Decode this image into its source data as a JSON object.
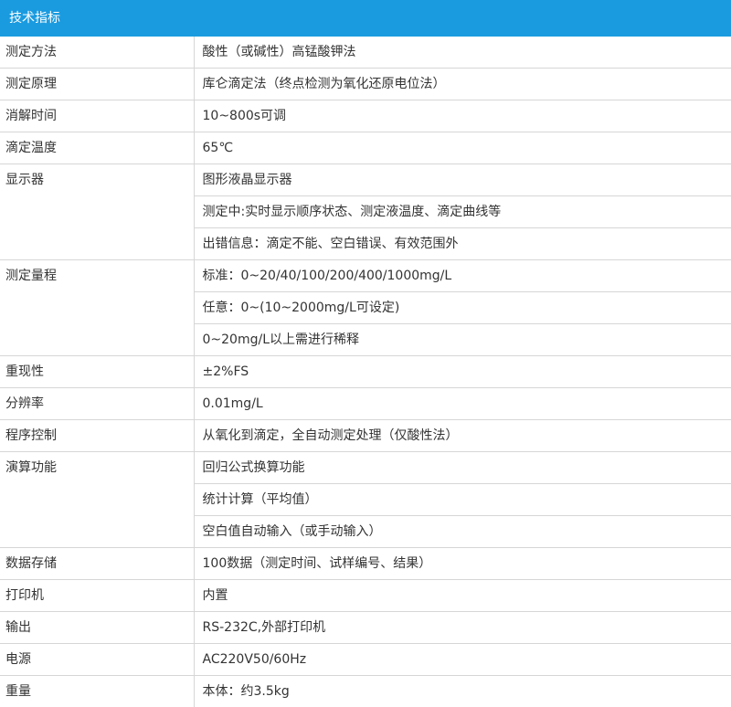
{
  "header": {
    "title": "技术指标"
  },
  "rows": [
    {
      "label": "测定方法",
      "values": [
        "酸性（或碱性）高锰酸钾法"
      ]
    },
    {
      "label": "测定原理",
      "values": [
        "库仑滴定法（终点检测为氧化还原电位法）"
      ]
    },
    {
      "label": "消解时间",
      "values": [
        "10~800s可调"
      ]
    },
    {
      "label": "滴定温度",
      "values": [
        "65℃"
      ]
    },
    {
      "label": "显示器",
      "values": [
        "图形液晶显示器",
        "测定中:实时显示顺序状态、测定液温度、滴定曲线等",
        "出错信息：滴定不能、空白错误、有效范围外"
      ]
    },
    {
      "label": "测定量程",
      "values": [
        "标准：0~20/40/100/200/400/1000mg/L",
        "任意：0~(10~2000mg/L可设定)",
        "0~20mg/L以上需进行稀释"
      ]
    },
    {
      "label": "重现性",
      "values": [
        "±2%FS"
      ]
    },
    {
      "label": "分辨率",
      "values": [
        "0.01mg/L"
      ]
    },
    {
      "label": "程序控制",
      "values": [
        "从氧化到滴定，全自动测定处理（仅酸性法）"
      ]
    },
    {
      "label": "演算功能",
      "values": [
        "回归公式换算功能",
        "统计计算（平均值）",
        "空白值自动输入（或手动输入）"
      ]
    },
    {
      "label": "数据存储",
      "values": [
        "100数据（测定时间、试样编号、结果）"
      ]
    },
    {
      "label": "打印机",
      "values": [
        "内置"
      ]
    },
    {
      "label": "输出",
      "values": [
        "RS-232C,外部打印机"
      ]
    },
    {
      "label": "电源",
      "values": [
        "AC220V50/60Hz"
      ]
    },
    {
      "label": "重量",
      "values": [
        "本体：约3.5kg"
      ]
    }
  ],
  "colors": {
    "header_bg": "#1a9be0",
    "border": "#d6d6d6",
    "text": "#333333"
  }
}
